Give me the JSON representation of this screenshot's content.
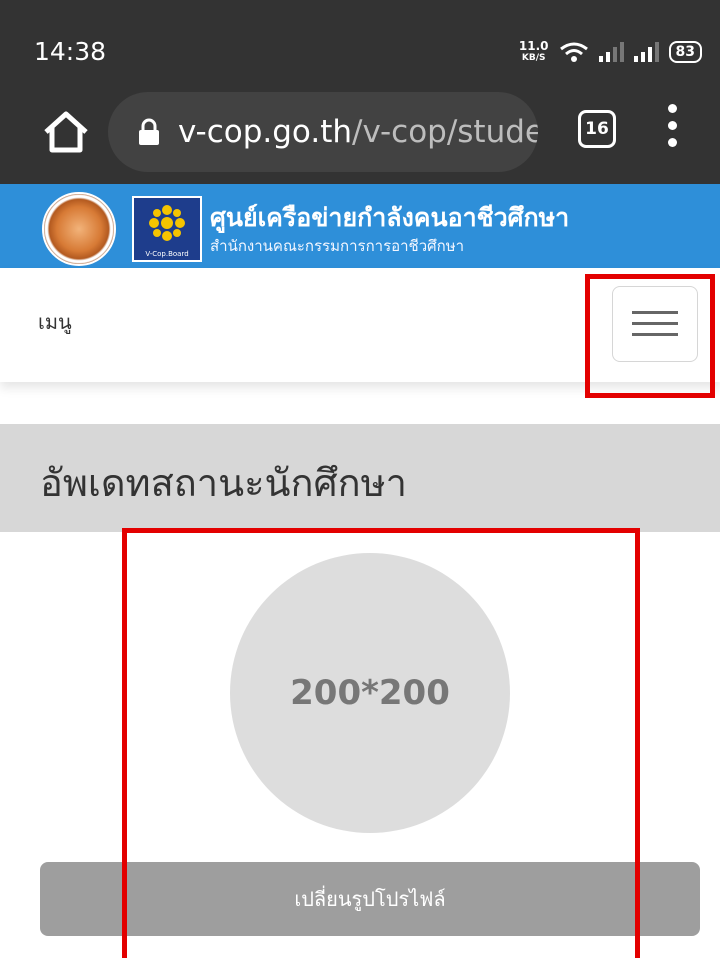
{
  "status_bar": {
    "time": "14:38",
    "net_speed_value": "11.0",
    "net_speed_unit": "KB/S",
    "battery": "83",
    "icons": [
      "wifi-icon",
      "signal-icon",
      "signal-icon",
      "battery-icon"
    ]
  },
  "browser": {
    "url_domain": "v-cop.go.th",
    "url_path": "/v-cop/studei",
    "tab_count": "16",
    "icons": [
      "home-icon",
      "lock-icon",
      "tabs-icon",
      "more-icon"
    ]
  },
  "site_header": {
    "title": "ศูนย์เครือข่ายกำลังคนอาชีวศึกษา",
    "subtitle": "สำนักงานคณะกรรมการการอาชีวศึกษา",
    "board_logo_text": "V-Cop.Board",
    "brand_color": "#2e8fd9"
  },
  "nav": {
    "menu_label": "เมนู",
    "toggle_icon": "hamburger-icon"
  },
  "page": {
    "title": "อัพเดทสถานะนักศึกษา",
    "avatar_placeholder": "200*200",
    "change_profile_button": "เปลี่ยนรูปโปรไฟล์"
  },
  "colors": {
    "status_bar_bg": "#333333",
    "highlight": "#e30000",
    "button_bg": "#9e9e9e"
  }
}
